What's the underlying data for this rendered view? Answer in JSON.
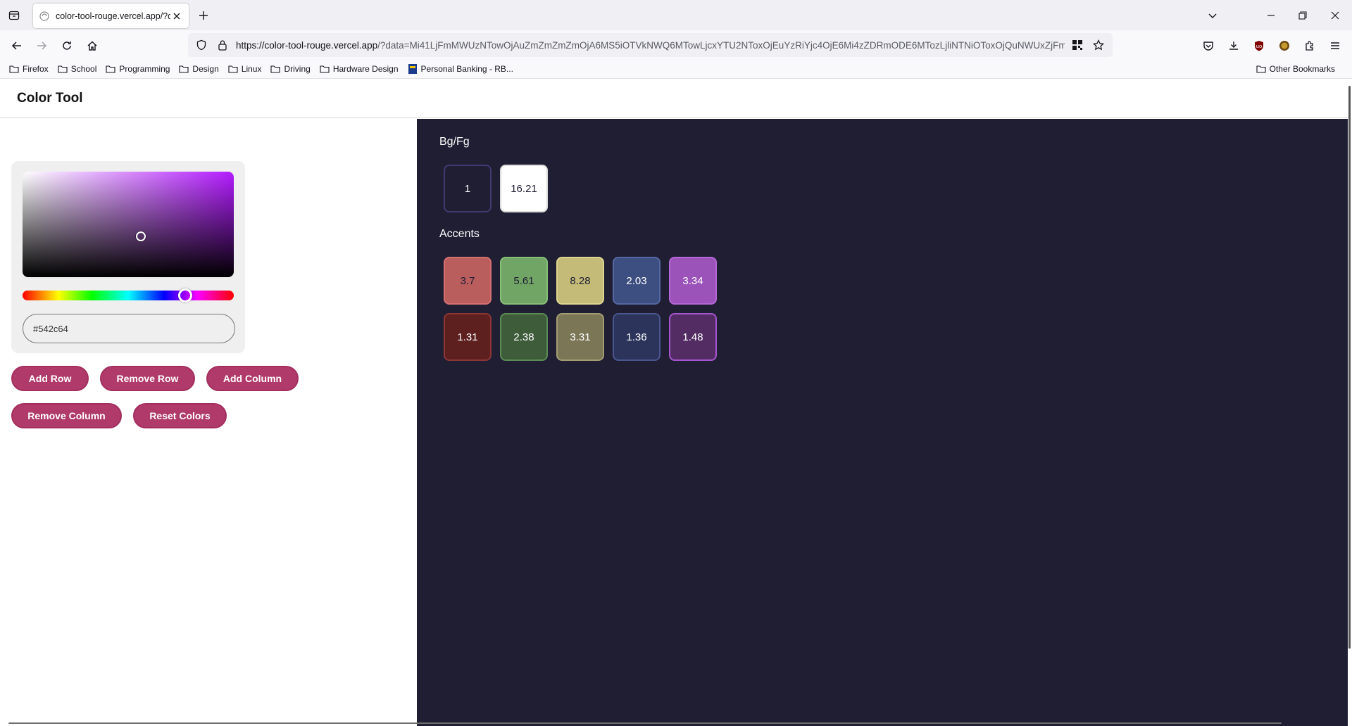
{
  "browser": {
    "tab_title": "color-tool-rouge.vercel.app/?d:",
    "url_host": "https://color-tool-rouge.vercel.app",
    "url_rest": "/?data=Mi41LjFmMWUzNTowOjAuZmZmZmZmOjA6MS5iOTVkNWQ6MTowLjcxYTU2NToxOjEuYzRiYjc4OjE6Mi4zZDRmODE6MTozLjliNTNiOToxOjQuNWUxZjFm",
    "bookmarks": [
      "Firefox",
      "School",
      "Programming",
      "Design",
      "Linux",
      "Driving",
      "Hardware Design",
      "Personal Banking - RB..."
    ],
    "other_bookmarks": "Other Bookmarks"
  },
  "app": {
    "title": "Color Tool",
    "background": "#1f1e33"
  },
  "picker": {
    "hex_value": "#542c64",
    "hue_fraction": 0.77,
    "saturation": 0.56,
    "brightness": 0.39
  },
  "buttons": {
    "add_row": "Add Row",
    "remove_row": "Remove Row",
    "add_column": "Add Column",
    "remove_column": "Remove Column",
    "reset_colors": "Reset Colors"
  },
  "palette": {
    "bgfg_label": "Bg/Fg",
    "accents_label": "Accents",
    "bgfg": [
      {
        "label": "1",
        "bg": "#1f1e33",
        "border": "#3e3b70",
        "text": "#ffffff"
      },
      {
        "label": "16.21",
        "bg": "#ffffff",
        "border": "#dcdcdc",
        "text": "#1f1e33"
      }
    ],
    "accents": [
      [
        {
          "label": "3.7",
          "bg": "#b95d5d",
          "border": "#d67070",
          "text": "#1f1e33"
        },
        {
          "label": "5.61",
          "bg": "#71a565",
          "border": "#86c078",
          "text": "#1f1e33"
        },
        {
          "label": "8.28",
          "bg": "#c4bb78",
          "border": "#ddd590",
          "text": "#1f1e33"
        },
        {
          "label": "2.03",
          "bg": "#3d4f81",
          "border": "#5668a3",
          "text": "#ffffff"
        },
        {
          "label": "3.34",
          "bg": "#9b53b9",
          "border": "#b468d6",
          "text": "#ffffff"
        }
      ],
      [
        {
          "label": "1.31",
          "bg": "#5e1f1f",
          "border": "#8c3636",
          "text": "#ffffff"
        },
        {
          "label": "2.38",
          "bg": "#3e5c3a",
          "border": "#5c8c55",
          "text": "#ffffff"
        },
        {
          "label": "3.31",
          "bg": "#7b7655",
          "border": "#a39d72",
          "text": "#ffffff"
        },
        {
          "label": "1.36",
          "bg": "#2c345c",
          "border": "#4a568e",
          "text": "#ffffff"
        },
        {
          "label": "1.48",
          "bg": "#542c64",
          "border": "#a655d0",
          "text": "#ffffff"
        }
      ]
    ]
  }
}
